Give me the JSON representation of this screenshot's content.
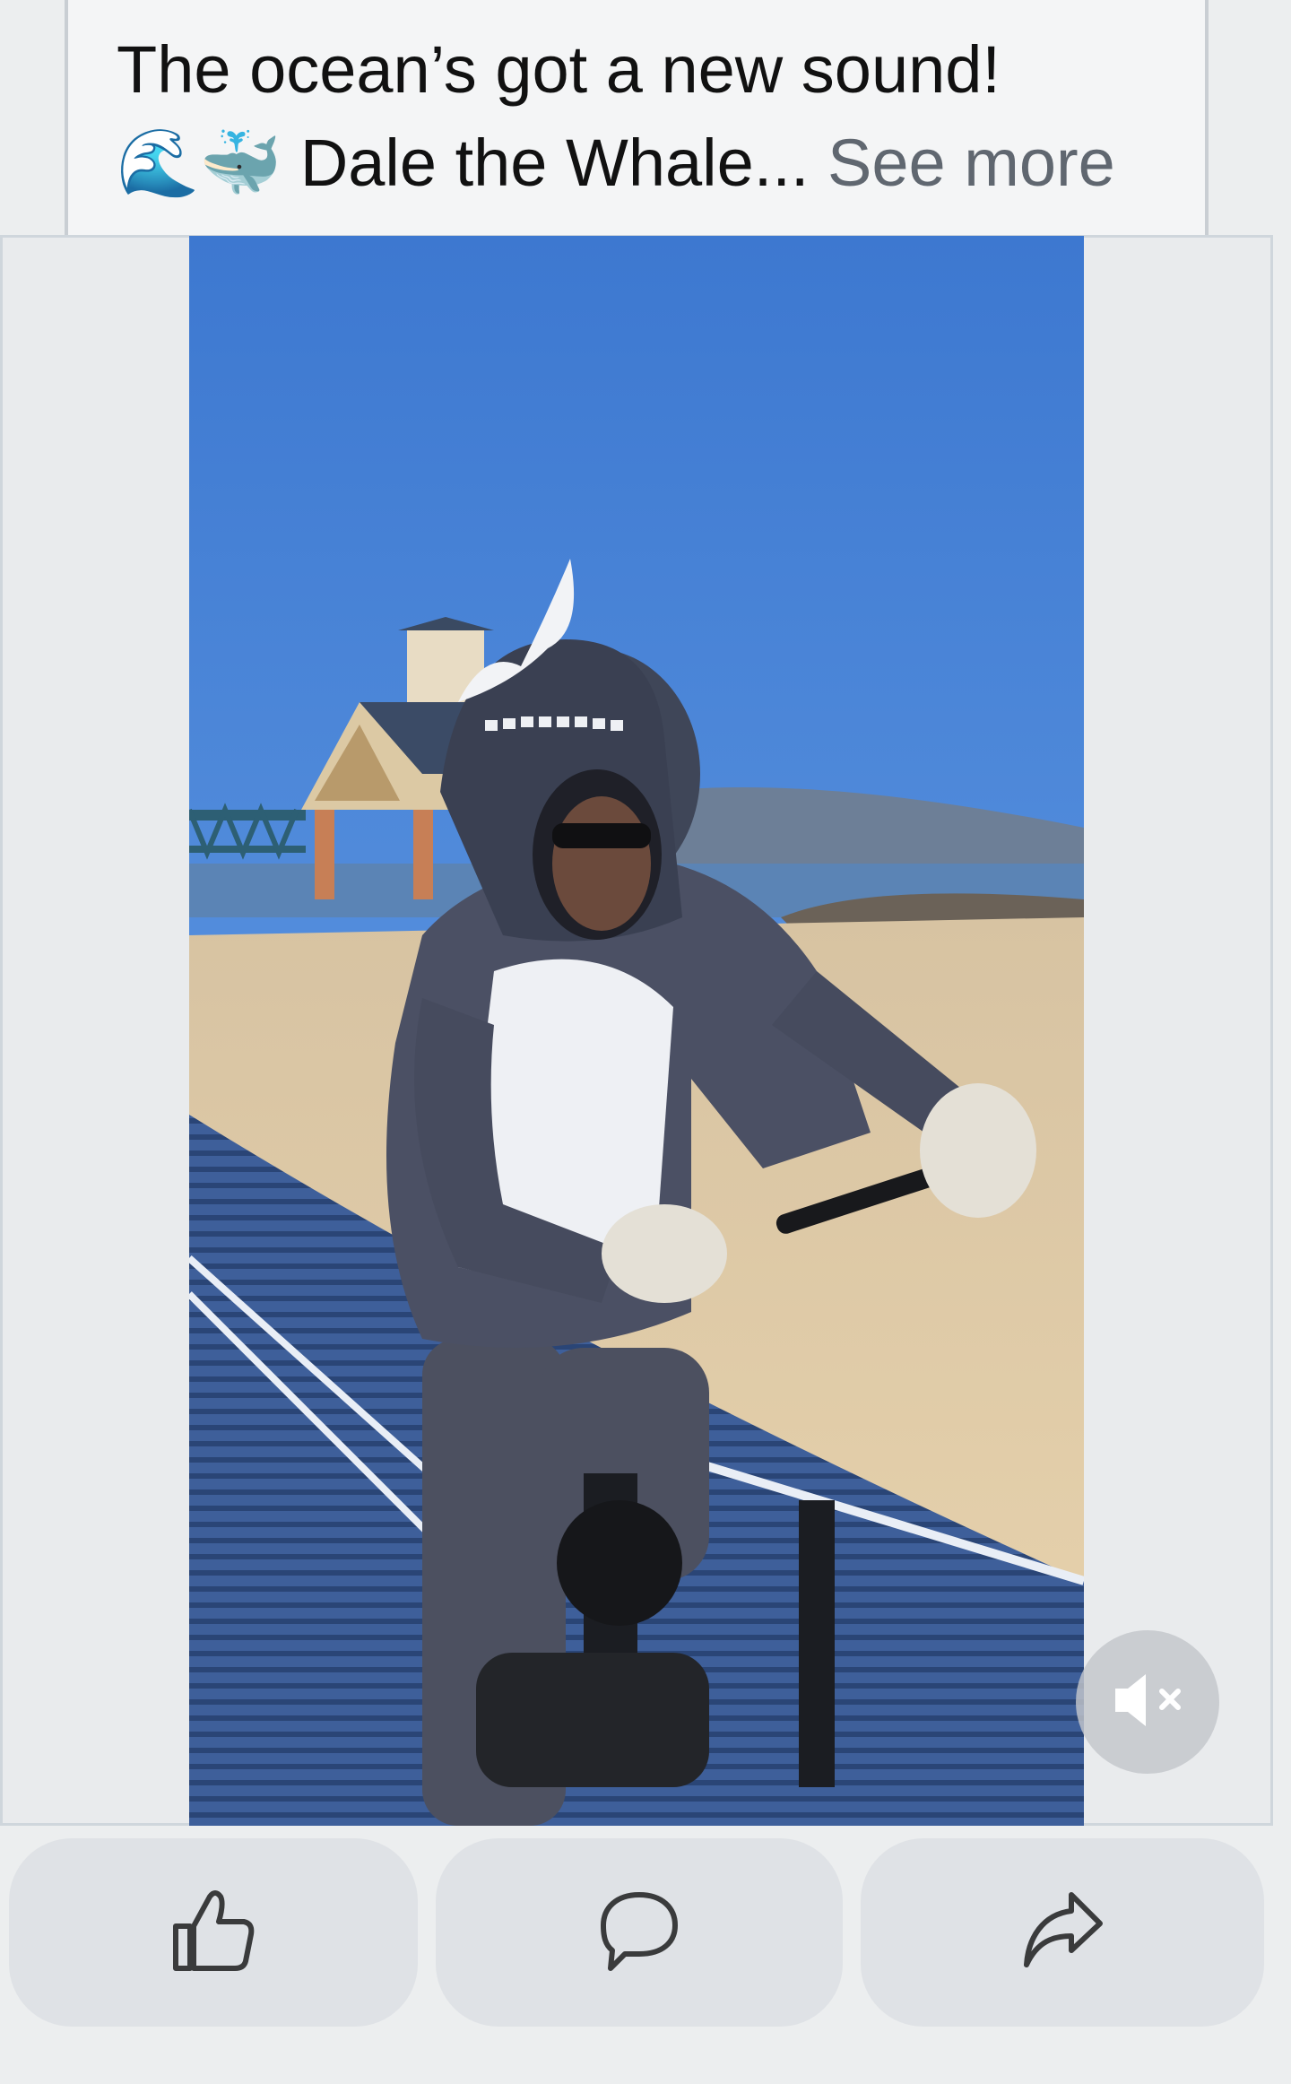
{
  "post": {
    "caption_line1": "The ocean’s got a new sound!",
    "caption_emoji_wave": "🌊",
    "caption_emoji_whale": "🐳",
    "caption_line2": " Dale the Whale...",
    "see_more_label": " See more"
  },
  "video": {
    "muted": true
  },
  "icons": {
    "mute": "speaker-muted-icon",
    "like": "thumbs-up-icon",
    "comment": "speech-bubble-icon",
    "share": "share-arrow-icon"
  },
  "colors": {
    "page_background": "#eceeef",
    "button_background": "#dfe2e6",
    "icon_stroke": "#3a3b3c",
    "see_more": "#606770"
  }
}
